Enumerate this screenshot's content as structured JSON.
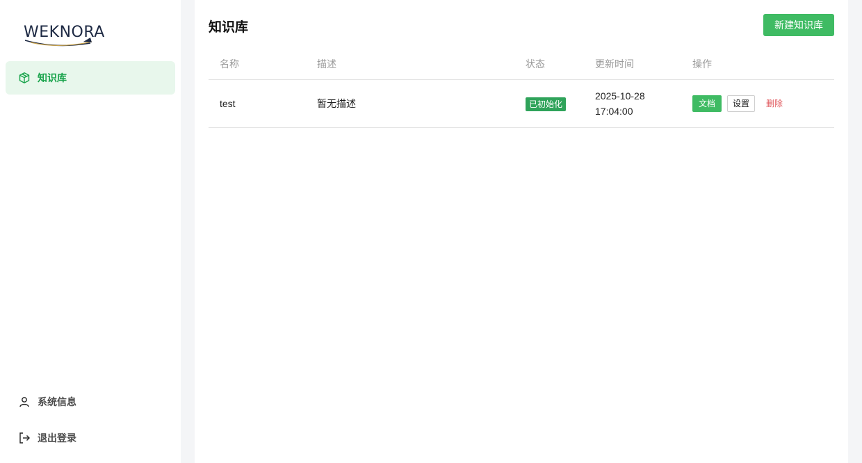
{
  "sidebar": {
    "logo_text": "WEKNORA",
    "nav": [
      {
        "label": "知识库",
        "icon": "cube-icon",
        "active": true
      }
    ],
    "bottom": [
      {
        "label": "系统信息",
        "icon": "user-icon"
      },
      {
        "label": "退出登录",
        "icon": "logout-icon"
      }
    ]
  },
  "header": {
    "title": "知识库",
    "new_button": "新建知识库"
  },
  "table": {
    "columns": [
      "名称",
      "描述",
      "状态",
      "更新时间",
      "操作"
    ],
    "rows": [
      {
        "name": "test",
        "description": "暂无描述",
        "status": "已初始化",
        "updated_date": "2025-10-28",
        "updated_time": "17:04:00",
        "actions": {
          "doc": "文档",
          "settings": "设置",
          "delete": "删除"
        }
      }
    ]
  },
  "colors": {
    "accent": "#3fbb63",
    "active_bg": "#e8f7ec",
    "status": "#2fa35a",
    "danger": "#e0565b"
  }
}
